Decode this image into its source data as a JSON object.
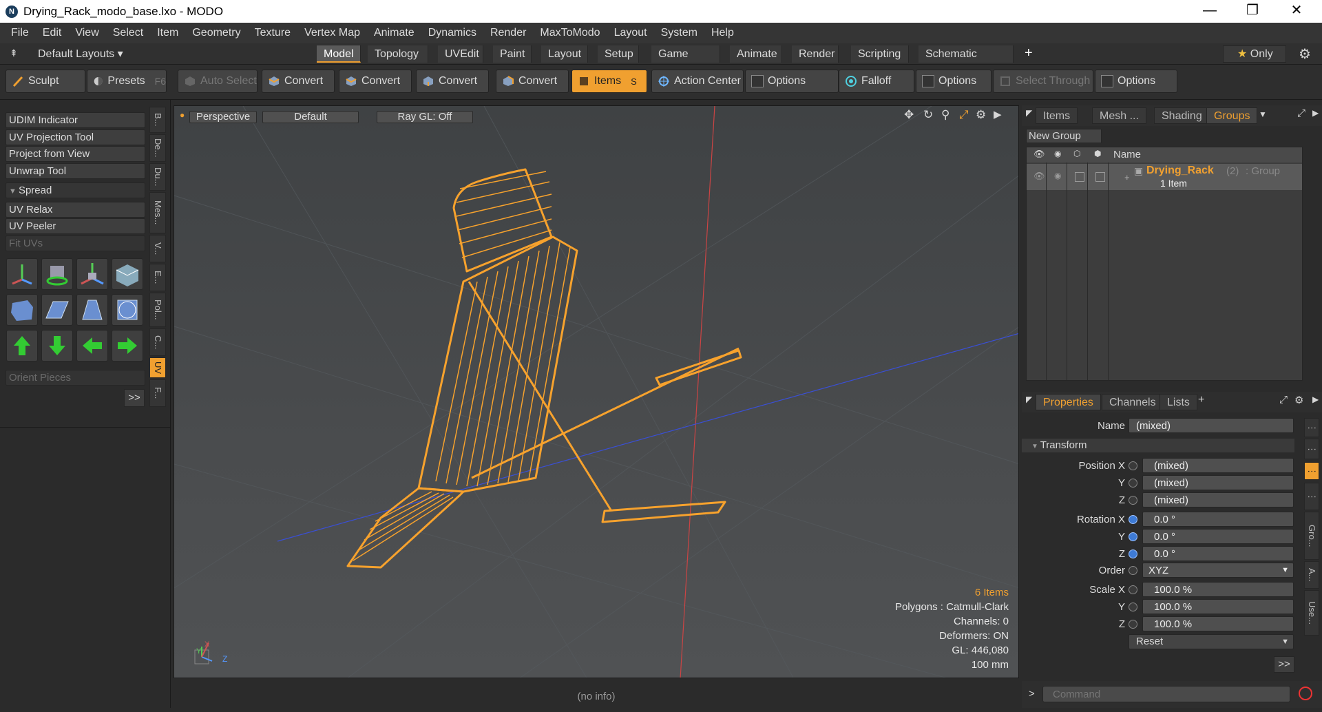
{
  "window": {
    "title": "Drying_Rack_modo_base.lxo - MODO",
    "logo_letter": "N",
    "minimize": "—",
    "restore": "❐",
    "close": "✕"
  },
  "menu": [
    "File",
    "Edit",
    "View",
    "Select",
    "Item",
    "Geometry",
    "Texture",
    "Vertex Map",
    "Animate",
    "Dynamics",
    "Render",
    "MaxToModo",
    "Layout",
    "System",
    "Help"
  ],
  "layout_selector": "Default Layouts",
  "layout_tabs": [
    "Model",
    "Topology",
    "UVEdit",
    "Paint",
    "Layout",
    "Setup",
    "Game Tools",
    "Animate",
    "Render",
    "Scripting",
    "Schematic Fusion"
  ],
  "add_tab": "+",
  "only_button": "Only",
  "toolbar": {
    "sculpt": "Sculpt",
    "presets": "Presets",
    "presets_key": "F6",
    "auto_select": "Auto Select",
    "convert": "Convert",
    "items": "Items",
    "items_key": "S",
    "action_center": "Action Center",
    "options": "Options",
    "falloff": "Falloff",
    "select_through": "Select Through"
  },
  "left_tools": {
    "udim": "UDIM Indicator",
    "uv_projection": "UV Projection Tool",
    "project_view": "Project from View",
    "unwrap": "Unwrap Tool",
    "spread": "Spread",
    "uv_relax": "UV Relax",
    "uv_peeler": "UV Peeler",
    "fit_uvs": "Fit UVs",
    "orient_pieces": "Orient Pieces",
    "more": ">>"
  },
  "left_vtabs": [
    "B...",
    "De...",
    "Du...",
    "Mes...",
    "V...",
    "E...",
    "Pol...",
    "C...",
    "UV",
    "F..."
  ],
  "viewport": {
    "view_mode": "Perspective",
    "shading": "Default",
    "raygl": "Ray GL: Off",
    "info": {
      "items": "6 Items",
      "polygons": "Polygons : Catmull-Clark",
      "channels": "Channels: 0",
      "deformers": "Deformers: ON",
      "gl": "GL: 446,080",
      "scale": "100 mm"
    },
    "axis_y": "Y",
    "axis_z": "Z",
    "axis_x": "X"
  },
  "status": "(no info)",
  "right_tabs": [
    "Items",
    "Mesh ...",
    "Shading",
    "Groups"
  ],
  "groups": {
    "new_group": "New Group",
    "col_name": "Name",
    "row_name": "Drying_Rack",
    "row_count": "(2)",
    "row_type": ": Group",
    "row_sub": "1 Item"
  },
  "prop_tabs": [
    "Properties",
    "Channels",
    "Lists"
  ],
  "properties": {
    "name_label": "Name",
    "name_value": "(mixed)",
    "transform": "Transform",
    "position_x_label": "Position X",
    "position_y_label": "Y",
    "position_z_label": "Z",
    "position_x": "(mixed)",
    "position_y": "(mixed)",
    "position_z": "(mixed)",
    "rotation_x_label": "Rotation X",
    "rotation_y_label": "Y",
    "rotation_z_label": "Z",
    "rotation_x": "0.0 °",
    "rotation_y": "0.0 °",
    "rotation_z": "0.0 °",
    "order_label": "Order",
    "order_value": "XYZ",
    "scale_x_label": "Scale X",
    "scale_y_label": "Y",
    "scale_z_label": "Z",
    "scale_x": "100.0 %",
    "scale_y": "100.0 %",
    "scale_z": "100.0 %",
    "reset": "Reset",
    "more": ">>"
  },
  "right_vtabs": [
    "Gro...",
    "A...",
    "Use..."
  ],
  "command": {
    "prompt": ">",
    "placeholder": "Command"
  },
  "colors": {
    "accent": "#f0a030",
    "viewport_bg": "#45484a",
    "panel": "#2b2b2b"
  }
}
